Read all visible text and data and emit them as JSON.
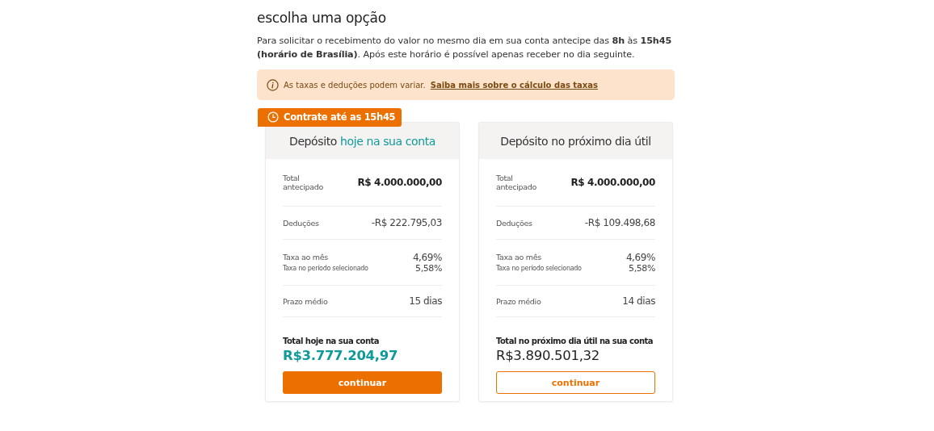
{
  "heading": "escolha uma opção",
  "intro": "Para solicitar o recebimento do valor no mesmo dia em sua conta antecipe das **8h** às **15h45 (horário de Brasília)**. Após este horário é possível apenas receber no dia seguinte.",
  "notice": {
    "text": "As taxas e deduções podem variar.",
    "link": "Saiba mais sobre o cálculo das taxas"
  },
  "options": [
    {
      "badge": "Contrate até as 15h45",
      "title": "Depósito",
      "title_highlight": "hoje na sua conta",
      "groups": [
        {
          "items": [
            {
              "label": "Total antecipado",
              "value": "R$ 4.000.000,00",
              "kind": "strong"
            }
          ]
        },
        {
          "items": [
            {
              "label": "Deduções",
              "value": "-R$ 222.795,03",
              "kind": "plain"
            }
          ]
        },
        {
          "items": [
            {
              "label": "Taxa ao mês",
              "value": "4,69%",
              "kind": "plain"
            },
            {
              "label": "Taxa no período selecionado",
              "value": "5,58%",
              "kind": "small"
            }
          ]
        },
        {
          "items": [
            {
              "label": "Prazo médio",
              "value": "15 dias",
              "kind": "plain"
            }
          ]
        }
      ],
      "total_label": "Total hoje na sua conta",
      "total": "R$3.777.204,97",
      "highlight": true,
      "button": {
        "label": "continuar",
        "kind": "primary"
      }
    },
    {
      "title": "Depósito no próximo dia útil",
      "groups": [
        {
          "items": [
            {
              "label": "Total antecipado",
              "value": "R$ 4.000.000,00",
              "kind": "strong"
            }
          ]
        },
        {
          "items": [
            {
              "label": "Deduções",
              "value": "-R$ 109.498,68",
              "kind": "plain"
            }
          ]
        },
        {
          "items": [
            {
              "label": "Taxa ao mês",
              "value": "4,69%",
              "kind": "plain"
            },
            {
              "label": "Taxa no período selecionado",
              "value": "5,58%",
              "kind": "small"
            }
          ]
        },
        {
          "items": [
            {
              "label": "Prazo médio",
              "value": "14 dias",
              "kind": "plain"
            }
          ]
        }
      ],
      "total_label": "Total no próximo dia útil na sua conta",
      "total": "R$3.890.501,32",
      "highlight": false,
      "button": {
        "label": "continuar",
        "kind": "outline"
      }
    }
  ]
}
